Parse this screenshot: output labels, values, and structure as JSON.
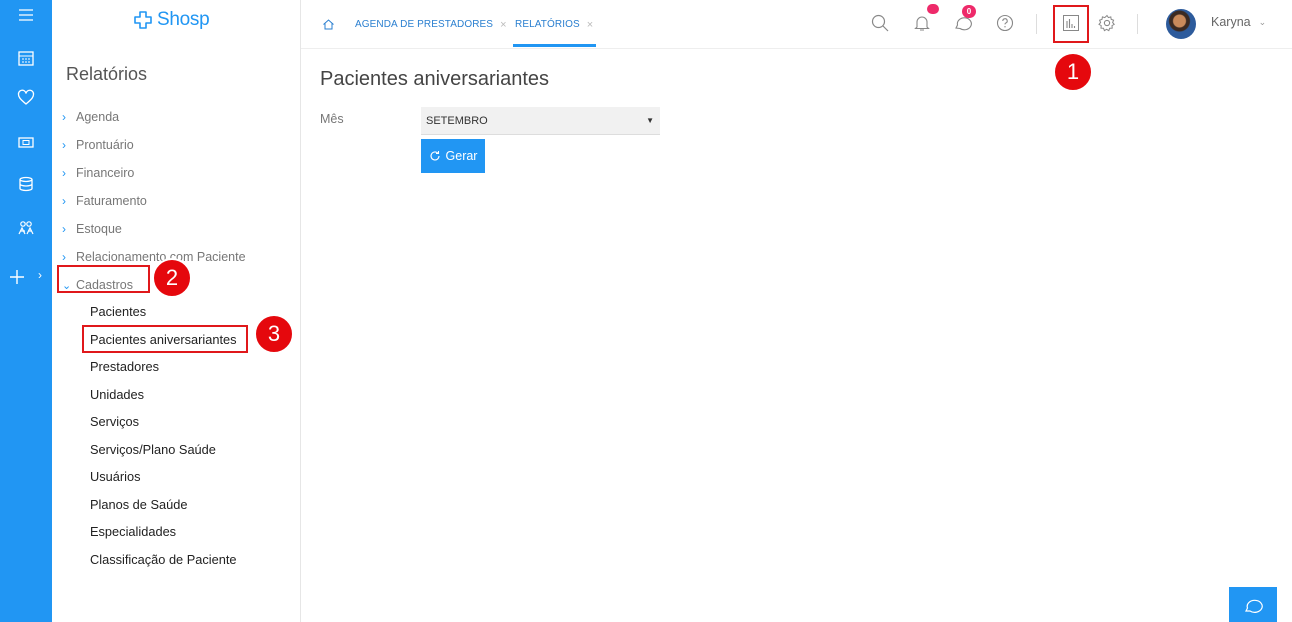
{
  "app": {
    "logo_text": "Shosp"
  },
  "sidebar": {
    "title": "Relatórios",
    "menu": [
      {
        "label": "Agenda",
        "expanded": false
      },
      {
        "label": "Prontuário",
        "expanded": false
      },
      {
        "label": "Financeiro",
        "expanded": false
      },
      {
        "label": "Faturamento",
        "expanded": false
      },
      {
        "label": "Estoque",
        "expanded": false
      },
      {
        "label": "Relacionamento com Paciente",
        "expanded": false
      },
      {
        "label": "Cadastros",
        "expanded": true
      }
    ],
    "submenu": [
      "Pacientes",
      "Pacientes aniversariantes",
      "Prestadores",
      "Unidades",
      "Serviços",
      "Serviços/Plano Saúde",
      "Usuários",
      "Planos de Saúde",
      "Especialidades",
      "Classificação de Paciente"
    ]
  },
  "topbar": {
    "tabs": [
      {
        "label": "AGENDA DE PRESTADORES",
        "active": false
      },
      {
        "label": "RELATÓRIOS",
        "active": true
      }
    ],
    "messages_count": "0",
    "user_name": "Karyna"
  },
  "main": {
    "title": "Pacientes aniversariantes",
    "month_label": "Mês",
    "month_value": "SETEMBRO",
    "generate_label": "Gerar"
  },
  "annotations": {
    "step1": "1",
    "step2": "2",
    "step3": "3"
  },
  "colors": {
    "primary": "#2196f3",
    "highlight": "#e0181b",
    "notification": "#ee2a6a"
  }
}
